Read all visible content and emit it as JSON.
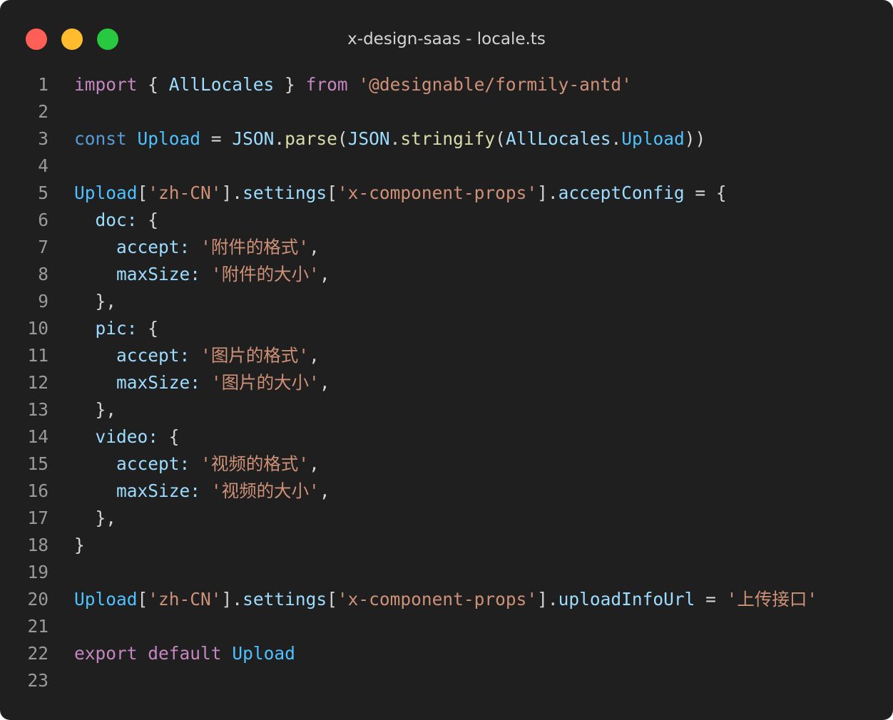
{
  "window": {
    "title": "x-design-saas - locale.ts"
  },
  "traffic_lights": {
    "close_color": "#ff5f57",
    "minimize_color": "#febc2e",
    "maximize_color": "#28c840"
  },
  "theme": {
    "background": "#1f1f1f",
    "keyword": "#c586c0",
    "storage": "#569cd6",
    "class_name": "#4fc1ff",
    "variable": "#9cdcfe",
    "function": "#dcdcaa",
    "string": "#ce9178",
    "punctuation": "#d4d4d4",
    "line_number": "#9a9a9a"
  },
  "code": {
    "lines": [
      {
        "n": "1",
        "tokens": [
          [
            "kw",
            "import"
          ],
          [
            "p",
            " { "
          ],
          [
            "vr",
            "AllLocales"
          ],
          [
            "p",
            " } "
          ],
          [
            "kw",
            "from"
          ],
          [
            "p",
            " "
          ],
          [
            "str",
            "'@designable/formily-antd'"
          ]
        ]
      },
      {
        "n": "2",
        "tokens": []
      },
      {
        "n": "3",
        "tokens": [
          [
            "bl",
            "const"
          ],
          [
            "p",
            " "
          ],
          [
            "st",
            "Upload"
          ],
          [
            "p",
            " = "
          ],
          [
            "vr",
            "JSON"
          ],
          [
            "p",
            "."
          ],
          [
            "fn",
            "parse"
          ],
          [
            "p",
            "("
          ],
          [
            "vr",
            "JSON"
          ],
          [
            "p",
            "."
          ],
          [
            "fn",
            "stringify"
          ],
          [
            "p",
            "("
          ],
          [
            "vr",
            "AllLocales"
          ],
          [
            "p",
            "."
          ],
          [
            "st",
            "Upload"
          ],
          [
            "p",
            "))"
          ]
        ]
      },
      {
        "n": "4",
        "tokens": []
      },
      {
        "n": "5",
        "tokens": [
          [
            "st",
            "Upload"
          ],
          [
            "p",
            "["
          ],
          [
            "str",
            "'zh-CN'"
          ],
          [
            "p",
            "]."
          ],
          [
            "vr",
            "settings"
          ],
          [
            "p",
            "["
          ],
          [
            "str",
            "'x-component-props'"
          ],
          [
            "p",
            "]."
          ],
          [
            "vr",
            "acceptConfig"
          ],
          [
            "p",
            " = {"
          ]
        ]
      },
      {
        "n": "6",
        "tokens": [
          [
            "p",
            "  "
          ],
          [
            "vr",
            "doc"
          ],
          [
            "vr",
            ":"
          ],
          [
            "p",
            " {"
          ]
        ]
      },
      {
        "n": "7",
        "tokens": [
          [
            "p",
            "    "
          ],
          [
            "vr",
            "accept"
          ],
          [
            "vr",
            ":"
          ],
          [
            "p",
            " "
          ],
          [
            "str",
            "'附件的格式'"
          ],
          [
            "p",
            ","
          ]
        ]
      },
      {
        "n": "8",
        "tokens": [
          [
            "p",
            "    "
          ],
          [
            "vr",
            "maxSize"
          ],
          [
            "vr",
            ":"
          ],
          [
            "p",
            " "
          ],
          [
            "str",
            "'附件的大小'"
          ],
          [
            "p",
            ","
          ]
        ]
      },
      {
        "n": "9",
        "tokens": [
          [
            "p",
            "  },"
          ]
        ]
      },
      {
        "n": "10",
        "tokens": [
          [
            "p",
            "  "
          ],
          [
            "vr",
            "pic"
          ],
          [
            "vr",
            ":"
          ],
          [
            "p",
            " {"
          ]
        ]
      },
      {
        "n": "11",
        "tokens": [
          [
            "p",
            "    "
          ],
          [
            "vr",
            "accept"
          ],
          [
            "vr",
            ":"
          ],
          [
            "p",
            " "
          ],
          [
            "str",
            "'图片的格式'"
          ],
          [
            "p",
            ","
          ]
        ]
      },
      {
        "n": "12",
        "tokens": [
          [
            "p",
            "    "
          ],
          [
            "vr",
            "maxSize"
          ],
          [
            "vr",
            ":"
          ],
          [
            "p",
            " "
          ],
          [
            "str",
            "'图片的大小'"
          ],
          [
            "p",
            ","
          ]
        ]
      },
      {
        "n": "13",
        "tokens": [
          [
            "p",
            "  },"
          ]
        ]
      },
      {
        "n": "14",
        "tokens": [
          [
            "p",
            "  "
          ],
          [
            "vr",
            "video"
          ],
          [
            "vr",
            ":"
          ],
          [
            "p",
            " {"
          ]
        ]
      },
      {
        "n": "15",
        "tokens": [
          [
            "p",
            "    "
          ],
          [
            "vr",
            "accept"
          ],
          [
            "vr",
            ":"
          ],
          [
            "p",
            " "
          ],
          [
            "str",
            "'视频的格式'"
          ],
          [
            "p",
            ","
          ]
        ]
      },
      {
        "n": "16",
        "tokens": [
          [
            "p",
            "    "
          ],
          [
            "vr",
            "maxSize"
          ],
          [
            "vr",
            ":"
          ],
          [
            "p",
            " "
          ],
          [
            "str",
            "'视频的大小'"
          ],
          [
            "p",
            ","
          ]
        ]
      },
      {
        "n": "17",
        "tokens": [
          [
            "p",
            "  },"
          ]
        ]
      },
      {
        "n": "18",
        "tokens": [
          [
            "p",
            "}"
          ]
        ]
      },
      {
        "n": "19",
        "tokens": []
      },
      {
        "n": "20",
        "tokens": [
          [
            "st",
            "Upload"
          ],
          [
            "p",
            "["
          ],
          [
            "str",
            "'zh-CN'"
          ],
          [
            "p",
            "]."
          ],
          [
            "vr",
            "settings"
          ],
          [
            "p",
            "["
          ],
          [
            "str",
            "'x-component-props'"
          ],
          [
            "p",
            "]."
          ],
          [
            "vr",
            "uploadInfoUrl"
          ],
          [
            "p",
            " = "
          ],
          [
            "str",
            "'上传接口'"
          ]
        ]
      },
      {
        "n": "21",
        "tokens": []
      },
      {
        "n": "22",
        "tokens": [
          [
            "kw",
            "export"
          ],
          [
            "p",
            " "
          ],
          [
            "kw",
            "default"
          ],
          [
            "p",
            " "
          ],
          [
            "st",
            "Upload"
          ]
        ]
      },
      {
        "n": "23",
        "tokens": []
      }
    ]
  }
}
